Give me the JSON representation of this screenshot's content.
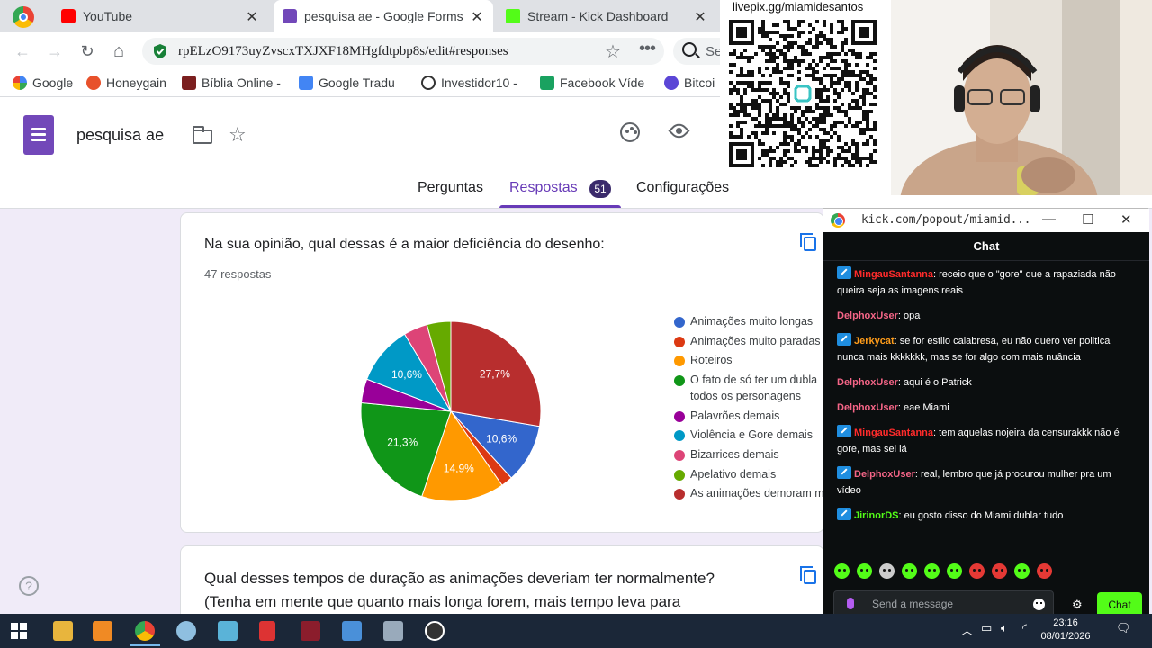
{
  "browser": {
    "tabs": [
      {
        "label": "YouTube",
        "color": "#ff0000"
      },
      {
        "label": "pesquisa ae - Google Forms",
        "color": "#7248b9"
      },
      {
        "label": "Stream - Kick Dashboard",
        "color": "#53fc18"
      }
    ],
    "url": "rpELzO9173uyZvscxTXJXF18MHgfdtpbp8s/edit#responses",
    "search_placeholder": "Se",
    "bookmarks": [
      "Google",
      "Honeygain",
      "Bíblia Online -",
      "Google Tradu",
      "Investidor10 -",
      "Facebook Víde",
      "Bitcoi"
    ]
  },
  "form": {
    "title": "pesquisa ae",
    "tabs": {
      "questions": "Perguntas",
      "responses": "Respostas",
      "responses_count": "51",
      "settings": "Configurações"
    },
    "question1": {
      "title": "Na sua opinião, qual dessas é a maior deficiência do desenho:",
      "count": "47 respostas"
    },
    "question2": {
      "title": "Qual desses tempos de duração as animações deveriam ter normalmente?",
      "subtitle": "(Tenha em mente que quanto mais longa forem, mais tempo leva para"
    }
  },
  "chart_data": {
    "type": "pie",
    "series": [
      {
        "name": "Animações muito longas",
        "value": 10.6,
        "color": "#3366cc",
        "label": "10,6%"
      },
      {
        "name": "Animações muito paradas",
        "value": 2.1,
        "color": "#dc3912",
        "label": ""
      },
      {
        "name": "Roteiros",
        "value": 14.9,
        "color": "#ff9900",
        "label": "14,9%"
      },
      {
        "name": "O fato de só ter um dublador para todos os personagens",
        "value": 21.3,
        "color": "#109618",
        "label": "21,3%"
      },
      {
        "name": "Palavrões demais",
        "value": 4.3,
        "color": "#990099",
        "label": ""
      },
      {
        "name": "Violência e Gore demais",
        "value": 10.6,
        "color": "#0099c6",
        "label": "10,6%"
      },
      {
        "name": "Bizarrices demais",
        "value": 4.3,
        "color": "#dd4477",
        "label": ""
      },
      {
        "name": "Apelativo demais",
        "value": 4.3,
        "color": "#66aa00",
        "label": ""
      },
      {
        "name": "As animações demoram muito",
        "value": 27.7,
        "color": "#b82e2e",
        "label": "27,7%"
      }
    ],
    "legend": [
      {
        "line1": "Animações muito longas",
        "line2": ""
      },
      {
        "line1": "Animações muito paradas",
        "line2": ""
      },
      {
        "line1": "Roteiros",
        "line2": ""
      },
      {
        "line1": "O fato de só ter um dubla",
        "line2": "todos os personagens"
      },
      {
        "line1": "Palavrões demais",
        "line2": ""
      },
      {
        "line1": "Violência e Gore demais",
        "line2": ""
      },
      {
        "line1": "Bizarrices demais",
        "line2": ""
      },
      {
        "line1": "Apelativo demais",
        "line2": ""
      },
      {
        "line1": "As animações demoram m",
        "line2": ""
      }
    ]
  },
  "overlay": {
    "pix_label": "livepix.gg/miamidesantos"
  },
  "chat": {
    "window_url": "kick.com/popout/miamid...",
    "header": "Chat",
    "messages": [
      {
        "user": "MingauSantanna",
        "color": "#ff2b2b",
        "badge": true,
        "text": "receio que o \"gore\" que a rapaziada não queira seja as imagens reais"
      },
      {
        "user": "DelphoxUser",
        "color": "#f56587",
        "badge": false,
        "text": "opa"
      },
      {
        "user": "Jerkycat",
        "color": "#ff9c1a",
        "badge": true,
        "text": "se for estilo calabresa, eu não quero ver politica nunca mais kkkkkkk, mas se for algo com mais nuância"
      },
      {
        "user": "DelphoxUser",
        "color": "#f56587",
        "badge": false,
        "text": "aqui é o Patrick"
      },
      {
        "user": "DelphoxUser",
        "color": "#f56587",
        "badge": false,
        "text": "eae Miami"
      },
      {
        "user": "MingauSantanna",
        "color": "#ff2b2b",
        "badge": true,
        "text": "tem aquelas nojeira da censurakkk não é gore, mas sei lá"
      },
      {
        "user": "DelphoxUser",
        "color": "#f56587",
        "badge": true,
        "text": "real, lembro que já procurou mulher pra um vídeo"
      },
      {
        "user": "JirinorDS",
        "color": "#53fc18",
        "badge": true,
        "text": "eu gosto disso do Miami dublar tudo"
      }
    ],
    "input_placeholder": "Send a message",
    "send_label": "Chat"
  },
  "taskbar": {
    "time": "23:16",
    "date": "08/01/2026"
  }
}
